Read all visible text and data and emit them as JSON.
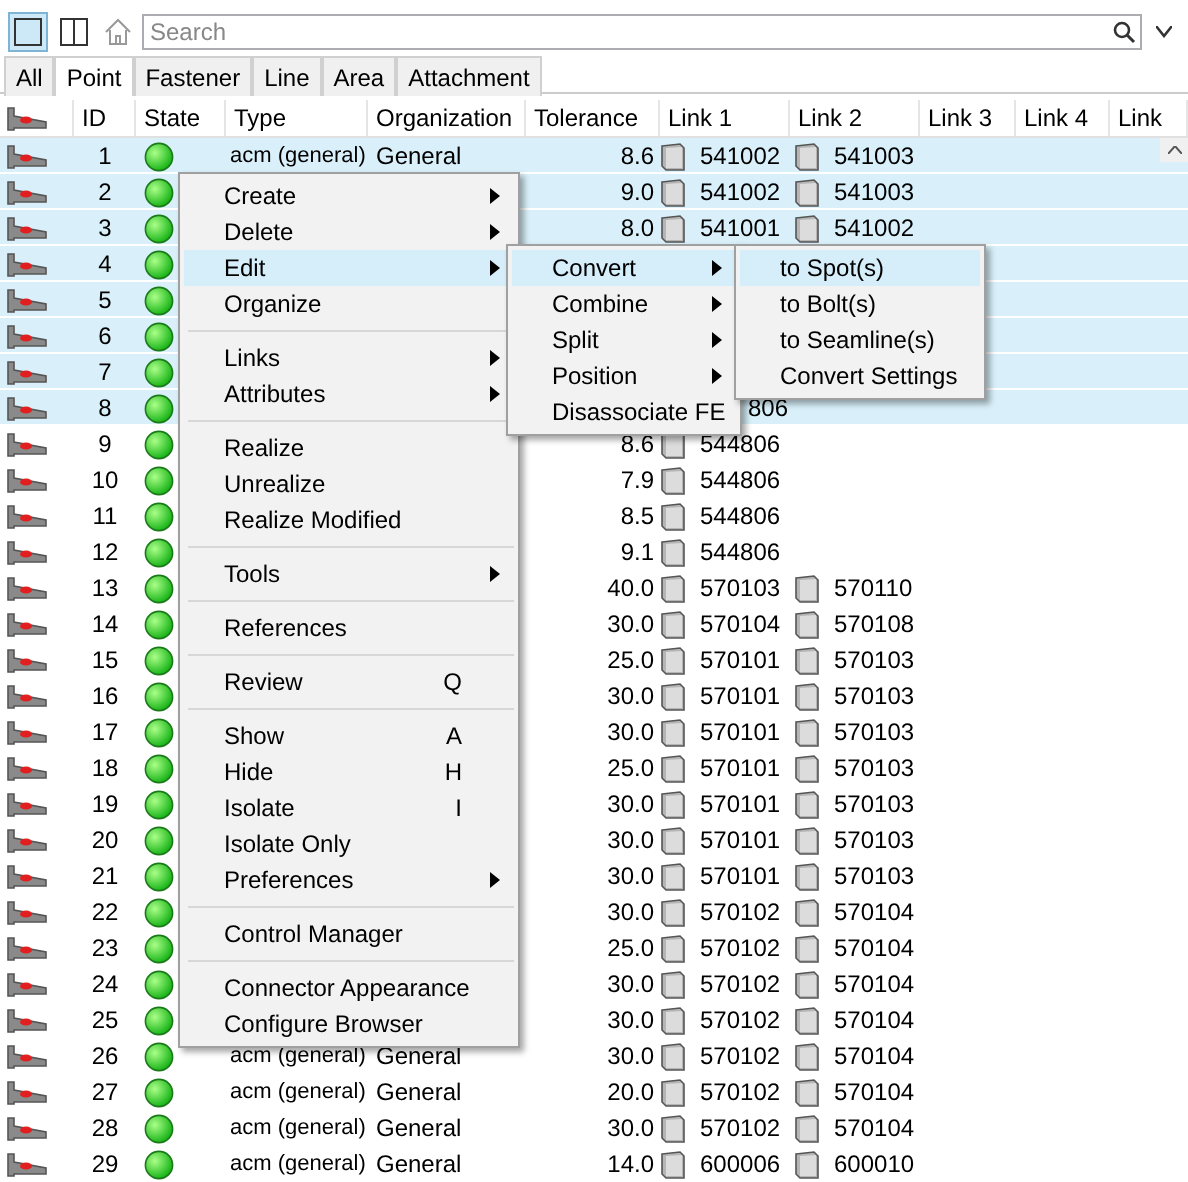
{
  "toolbar": {
    "search": {
      "placeholder": "Search"
    },
    "layouts": [
      {
        "selected": true
      },
      {
        "selected": false
      }
    ]
  },
  "tabs": [
    {
      "label": "All",
      "selected": false
    },
    {
      "label": "Point",
      "selected": true
    },
    {
      "label": "Fastener",
      "selected": false
    },
    {
      "label": "Line",
      "selected": false
    },
    {
      "label": "Area",
      "selected": false
    },
    {
      "label": "Attachment",
      "selected": false
    }
  ],
  "table": {
    "columns": [
      "ID",
      "State",
      "Type",
      "Organization",
      "Tolerance",
      "Link 1",
      "Link 2",
      "Link 3",
      "Link 4",
      "Link"
    ],
    "rows": [
      {
        "id": "1",
        "selected": true,
        "type": "acm (general)",
        "organization": "General",
        "tolerance": "8.6",
        "link1": "541002",
        "link2": "541003"
      },
      {
        "id": "2",
        "selected": true,
        "tolerance": "9.0",
        "link1": "541002",
        "link2": "541003"
      },
      {
        "id": "3",
        "selected": true,
        "tolerance": "8.0",
        "link1": "541001",
        "link2": "541002"
      },
      {
        "id": "4",
        "selected": true
      },
      {
        "id": "5",
        "selected": true
      },
      {
        "id": "6",
        "selected": true
      },
      {
        "id": "7",
        "selected": true
      },
      {
        "id": "8",
        "selected": true,
        "link1_clipped": "806"
      },
      {
        "id": "9",
        "selected": false,
        "tolerance": "8.6",
        "link1": "544806"
      },
      {
        "id": "10",
        "selected": false,
        "tolerance": "7.9",
        "link1": "544806"
      },
      {
        "id": "11",
        "selected": false,
        "tolerance": "8.5",
        "link1": "544806"
      },
      {
        "id": "12",
        "selected": false,
        "tolerance": "9.1",
        "link1": "544806"
      },
      {
        "id": "13",
        "selected": false,
        "tolerance": "40.0",
        "link1": "570103",
        "link2": "570110"
      },
      {
        "id": "14",
        "selected": false,
        "tolerance": "30.0",
        "link1": "570104",
        "link2": "570108"
      },
      {
        "id": "15",
        "selected": false,
        "tolerance": "25.0",
        "link1": "570101",
        "link2": "570103"
      },
      {
        "id": "16",
        "selected": false,
        "tolerance": "30.0",
        "link1": "570101",
        "link2": "570103"
      },
      {
        "id": "17",
        "selected": false,
        "tolerance": "30.0",
        "link1": "570101",
        "link2": "570103"
      },
      {
        "id": "18",
        "selected": false,
        "tolerance": "25.0",
        "link1": "570101",
        "link2": "570103"
      },
      {
        "id": "19",
        "selected": false,
        "tolerance": "30.0",
        "link1": "570101",
        "link2": "570103"
      },
      {
        "id": "20",
        "selected": false,
        "tolerance": "30.0",
        "link1": "570101",
        "link2": "570103"
      },
      {
        "id": "21",
        "selected": false,
        "tolerance": "30.0",
        "link1": "570101",
        "link2": "570103"
      },
      {
        "id": "22",
        "selected": false,
        "tolerance": "30.0",
        "link1": "570102",
        "link2": "570104"
      },
      {
        "id": "23",
        "selected": false,
        "tolerance": "25.0",
        "link1": "570102",
        "link2": "570104"
      },
      {
        "id": "24",
        "selected": false,
        "tolerance": "30.0",
        "link1": "570102",
        "link2": "570104"
      },
      {
        "id": "25",
        "selected": false,
        "tolerance": "30.0",
        "link1": "570102",
        "link2": "570104"
      },
      {
        "id": "26",
        "selected": false,
        "type": "acm (general)",
        "organization": "General",
        "tolerance": "30.0",
        "link1": "570102",
        "link2": "570104"
      },
      {
        "id": "27",
        "selected": false,
        "type": "acm (general)",
        "organization": "General",
        "tolerance": "20.0",
        "link1": "570102",
        "link2": "570104"
      },
      {
        "id": "28",
        "selected": false,
        "type": "acm (general)",
        "organization": "General",
        "tolerance": "30.0",
        "link1": "570102",
        "link2": "570104"
      },
      {
        "id": "29",
        "selected": false,
        "type": "acm (general)",
        "organization": "General",
        "tolerance": "14.0",
        "link1": "600006",
        "link2": "600010"
      }
    ]
  },
  "context_menu": {
    "groups": [
      [
        {
          "label": "Create",
          "submenu": true,
          "selected": false
        },
        {
          "label": "Delete",
          "submenu": true,
          "selected": false
        },
        {
          "label": "Edit",
          "submenu": true,
          "selected": true
        },
        {
          "label": "Organize",
          "submenu": false,
          "selected": false
        }
      ],
      [
        {
          "label": "Links",
          "submenu": true,
          "selected": false
        },
        {
          "label": "Attributes",
          "submenu": true,
          "selected": false
        }
      ],
      [
        {
          "label": "Realize",
          "submenu": false,
          "selected": false
        },
        {
          "label": "Unrealize",
          "submenu": false,
          "selected": false
        },
        {
          "label": "Realize Modified",
          "submenu": false,
          "selected": false
        }
      ],
      [
        {
          "label": "Tools",
          "submenu": true,
          "selected": false
        }
      ],
      [
        {
          "label": "References",
          "submenu": false,
          "selected": false
        }
      ],
      [
        {
          "label": "Review",
          "shortcut": "Q",
          "submenu": false,
          "selected": false
        }
      ],
      [
        {
          "label": "Show",
          "shortcut": "A",
          "submenu": false,
          "selected": false
        },
        {
          "label": "Hide",
          "shortcut": "H",
          "submenu": false,
          "selected": false
        },
        {
          "label": "Isolate",
          "shortcut": "I",
          "submenu": false,
          "selected": false
        },
        {
          "label": "Isolate Only",
          "submenu": false,
          "selected": false
        },
        {
          "label": "Preferences",
          "submenu": true,
          "selected": false
        }
      ],
      [
        {
          "label": "Control Manager",
          "submenu": false,
          "selected": false
        }
      ],
      [
        {
          "label": "Connector Appearance",
          "submenu": false,
          "selected": false
        },
        {
          "label": "Configure Browser",
          "submenu": false,
          "selected": false
        }
      ]
    ]
  },
  "edit_submenu": {
    "groups": [
      [
        {
          "label": "Convert",
          "submenu": true,
          "selected": true
        },
        {
          "label": "Combine",
          "submenu": true,
          "selected": false
        },
        {
          "label": "Split",
          "submenu": true,
          "selected": false
        },
        {
          "label": "Position",
          "submenu": true,
          "selected": false
        },
        {
          "label": "Disassociate FE",
          "submenu": false,
          "selected": false
        }
      ]
    ]
  },
  "convert_submenu": {
    "groups": [
      [
        {
          "label": "to Spot(s)",
          "submenu": false,
          "selected": true
        },
        {
          "label": "to Bolt(s)",
          "submenu": false,
          "selected": false
        },
        {
          "label": "to Seamline(s)",
          "submenu": false,
          "selected": false
        },
        {
          "label": "Convert Settings",
          "submenu": false,
          "selected": false
        }
      ]
    ]
  }
}
